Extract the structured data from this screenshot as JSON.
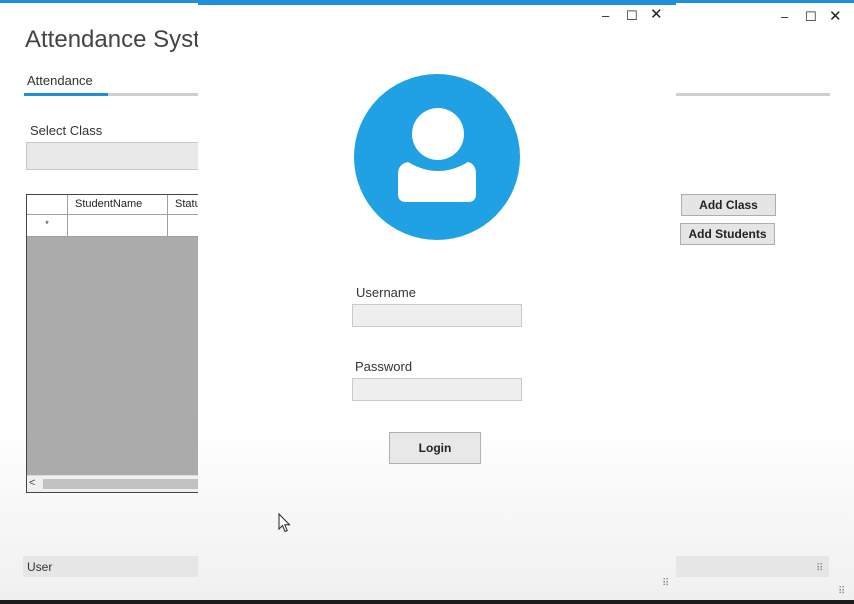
{
  "main_window": {
    "title": "Attendance System",
    "tab_label": "Attendance",
    "select_class_label": "Select Class",
    "grid": {
      "columns": [
        "StudentName",
        "Status"
      ],
      "new_row_marker": "*"
    },
    "buttons": {
      "add_class": "Add Class",
      "add_students": "Add Students"
    },
    "status_text": "User",
    "controls": {
      "minimize": "–",
      "maximize": "☐",
      "close": "✕"
    }
  },
  "login": {
    "username_label": "Username",
    "password_label": "Password",
    "username_value": "",
    "password_value": "",
    "login_button": "Login",
    "controls": {
      "minimize": "–",
      "maximize": "☐",
      "close": "✕"
    }
  },
  "icons": {
    "avatar": "user-avatar-icon",
    "dropdown": "chevron-down-icon",
    "scroll_left": "chevron-left-icon",
    "resize_grip": "resize-grip-icon",
    "cursor": "mouse-pointer-icon"
  },
  "colors": {
    "accent": "#1f8fd9",
    "avatar_circle": "#1fa1e3",
    "grid_background": "#ababab"
  }
}
